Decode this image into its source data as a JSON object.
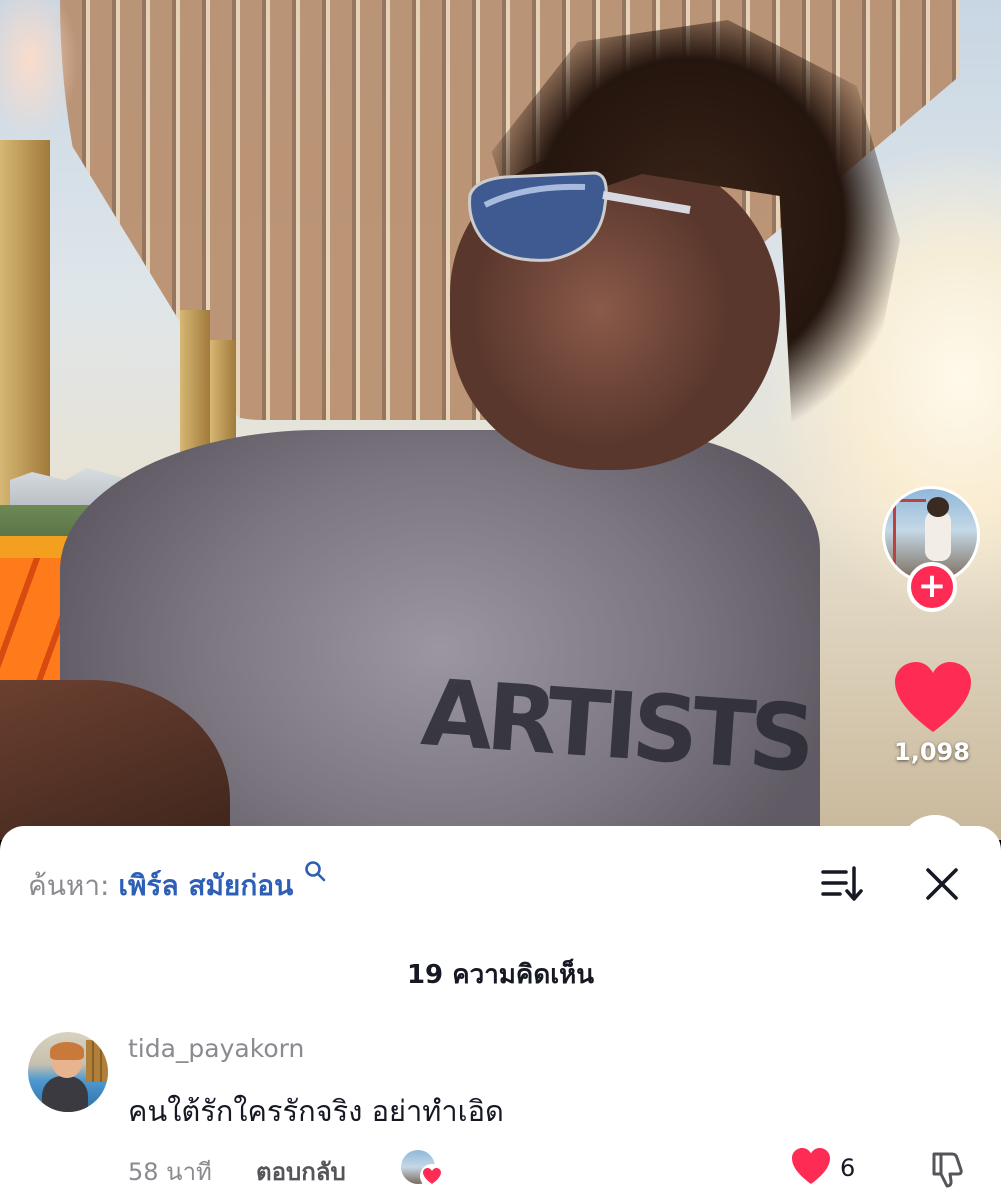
{
  "video": {
    "shirt_print": "ARTISTS",
    "creator_avatar": "creator-avatar-icon",
    "follow_icon": "plus-icon",
    "like_icon": "heart-icon",
    "like_count": "1,098",
    "accent_color": "#fe2c55"
  },
  "comments_sheet": {
    "search_prefix": "ค้นหา:",
    "search_query": "เพิร์ล สมัยก่อน",
    "count_label": "19 ความคิดเห็น",
    "comments": [
      {
        "username": "tida_payakorn",
        "text": "คนใต้รักใครรักจริง อย่าทำเอิด",
        "time": "58 นาที",
        "reply_label": "ตอบกลับ",
        "like_count": "6"
      }
    ]
  }
}
